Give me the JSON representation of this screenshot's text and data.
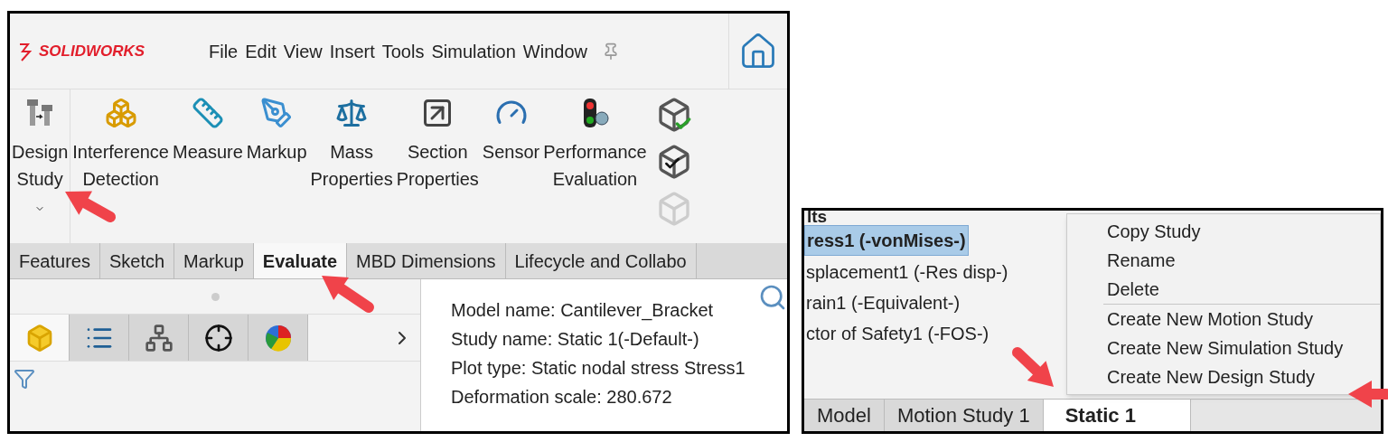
{
  "left_window": {
    "logo": "SOLIDWORKS",
    "menu": [
      "File",
      "Edit",
      "View",
      "Insert",
      "Tools",
      "Simulation",
      "Window"
    ],
    "tools": [
      {
        "lines": [
          "Design",
          "Study"
        ]
      },
      {
        "lines": [
          "Interference",
          "Detection"
        ]
      },
      {
        "lines": [
          "Measure"
        ]
      },
      {
        "lines": [
          "Markup"
        ]
      },
      {
        "lines": [
          "Mass",
          "Properties"
        ]
      },
      {
        "lines": [
          "Section",
          "Properties"
        ]
      },
      {
        "lines": [
          "Sensor"
        ]
      },
      {
        "lines": [
          "Performance",
          "Evaluation"
        ]
      }
    ],
    "tabs": [
      {
        "label": "Features",
        "selected": false
      },
      {
        "label": "Sketch",
        "selected": false
      },
      {
        "label": "Markup",
        "selected": false
      },
      {
        "label": "Evaluate",
        "selected": true
      },
      {
        "label": "MBD Dimensions",
        "selected": false
      },
      {
        "label": "Lifecycle and Collabo",
        "selected": false
      }
    ],
    "pane_tabs": [
      {
        "selected": true
      },
      {
        "selected": false
      },
      {
        "selected": false
      },
      {
        "selected": false
      },
      {
        "selected": false
      }
    ],
    "info": [
      "Model name: Cantilever_Bracket",
      "Study name: Static 1(-Default-)",
      "Plot type: Static nodal stress Stress1",
      "Deformation scale: 280.672"
    ]
  },
  "right_window": {
    "heading": "lts",
    "results": [
      {
        "label": "ress1 (-vonMises-)",
        "selected": true
      },
      {
        "label": "splacement1 (-Res disp-)",
        "selected": false
      },
      {
        "label": "rain1 (-Equivalent-)",
        "selected": false
      },
      {
        "label": "ctor of Safety1 (-FOS-)",
        "selected": false
      }
    ],
    "bottom_tabs": [
      {
        "label": "Model",
        "selected": false
      },
      {
        "label": "Motion Study 1",
        "selected": false
      },
      {
        "label": "Static 1",
        "selected": true
      }
    ],
    "context_menu": [
      {
        "label": "Copy Study",
        "divider_after": false
      },
      {
        "label": "Rename",
        "divider_after": false
      },
      {
        "label": "Delete",
        "divider_after": true
      },
      {
        "label": "Create New Motion Study",
        "divider_after": false
      },
      {
        "label": "Create New Simulation Study",
        "divider_after": false
      },
      {
        "label": "Create New Design Study",
        "divider_after": false
      }
    ]
  }
}
